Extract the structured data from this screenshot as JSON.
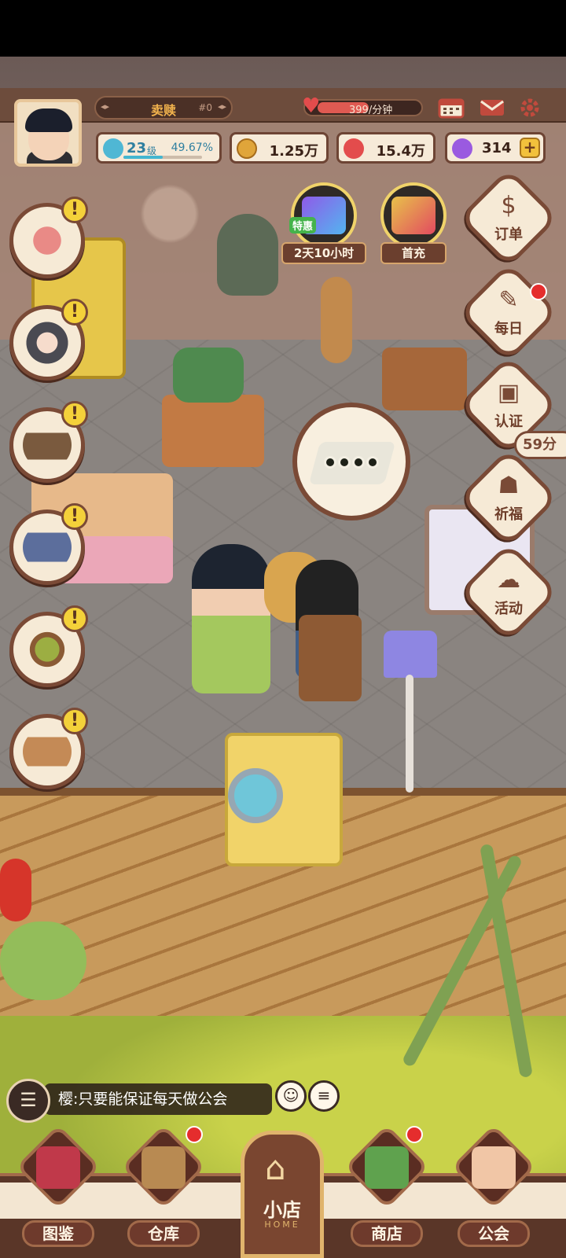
{
  "hud": {
    "title_label": "卖赎",
    "title_rank": "#0",
    "rate_text": "399/分钟",
    "level": "23",
    "level_unit": "级",
    "level_progress": "49.67%",
    "coins": "1.25万",
    "hearts": "15.4万",
    "gems": "314",
    "gem_plus": "+"
  },
  "promos": [
    {
      "tag": "特惠",
      "caption": "2天10小时"
    },
    {
      "caption": "首充"
    }
  ],
  "right_menu": [
    {
      "label": "订单",
      "glyph": "$"
    },
    {
      "label": "每日",
      "glyph": "✎"
    },
    {
      "label": "认证",
      "glyph": "▣"
    },
    {
      "label": "祈福",
      "glyph": "☗"
    },
    {
      "label": "活动",
      "glyph": "☁"
    }
  ],
  "timer_text": "59分",
  "chat": {
    "message": "樱:只要能保证每天做公会",
    "icon": "chat-bubble-icon"
  },
  "nav": {
    "items": [
      {
        "label": "图鉴"
      },
      {
        "label": "仓库"
      },
      {
        "label": "商店"
      },
      {
        "label": "公会"
      }
    ],
    "home_label": "小店",
    "home_sub": "HOME"
  },
  "colors": {
    "hud_brown": "#6d4c3c",
    "accent_gold": "#f2b34d",
    "alert_yellow": "#f4d13a",
    "badge_red": "#e52d2d"
  }
}
